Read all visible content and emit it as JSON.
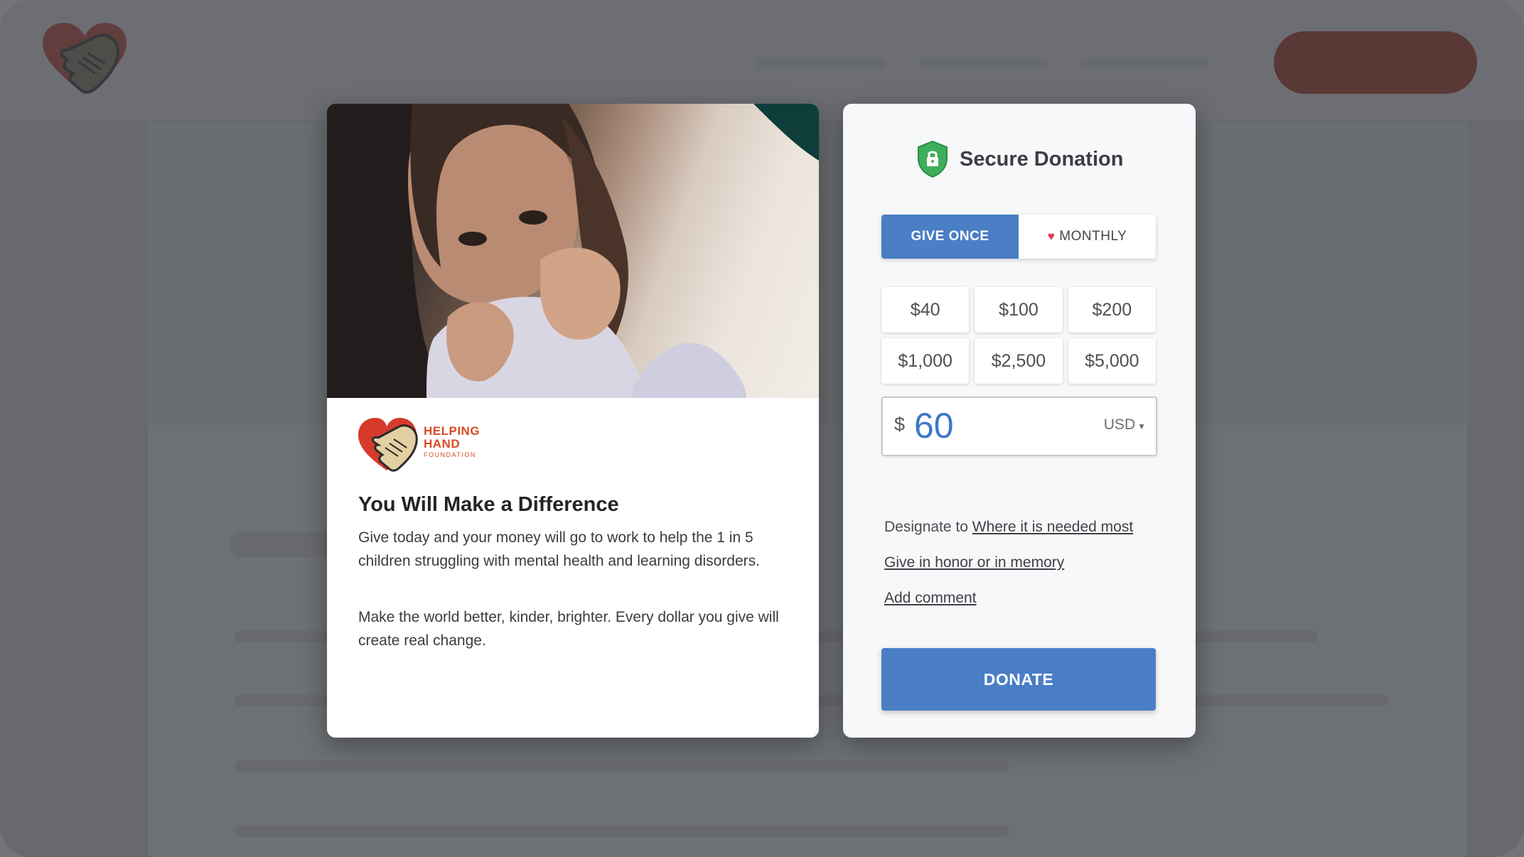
{
  "site": {
    "header": {
      "logo_icon": "heart-handshake-icon",
      "cta_color": "#a52813"
    }
  },
  "campaign": {
    "photo_alt": "girl-wrapped-in-sweater-photo",
    "org": {
      "name_line1": "HELPING",
      "name_line2": "HAND",
      "name_line3": "FOUNDATION",
      "logo_icon": "heart-handshake-icon",
      "brand_color": "#d84a23"
    },
    "title": "You Will Make a Difference",
    "paragraph1": "Give today and your money will go to work to help the 1 in 5 children struggling with mental health and learning disorders.",
    "paragraph2": "Make the world better, kinder, brighter. Every dollar you give will create real change."
  },
  "donation": {
    "title": "Secure Donation",
    "shield_icon": "shield-lock-icon",
    "frequency": {
      "once_label": "GIVE ONCE",
      "monthly_label": "MONTHLY",
      "monthly_icon": "heart-icon",
      "selected": "once"
    },
    "preset_amounts": [
      "$40",
      "$100",
      "$200",
      "$1,000",
      "$2,500",
      "$5,000"
    ],
    "currency_symbol": "$",
    "amount_value": "60",
    "currency": "USD",
    "designate_prefix": "Designate to ",
    "designate_link": "Where it is needed most",
    "honor_link": "Give in honor or in memory",
    "comment_link": "Add comment",
    "donate_label": "DONATE",
    "accent_color": "#4a7ec5"
  }
}
